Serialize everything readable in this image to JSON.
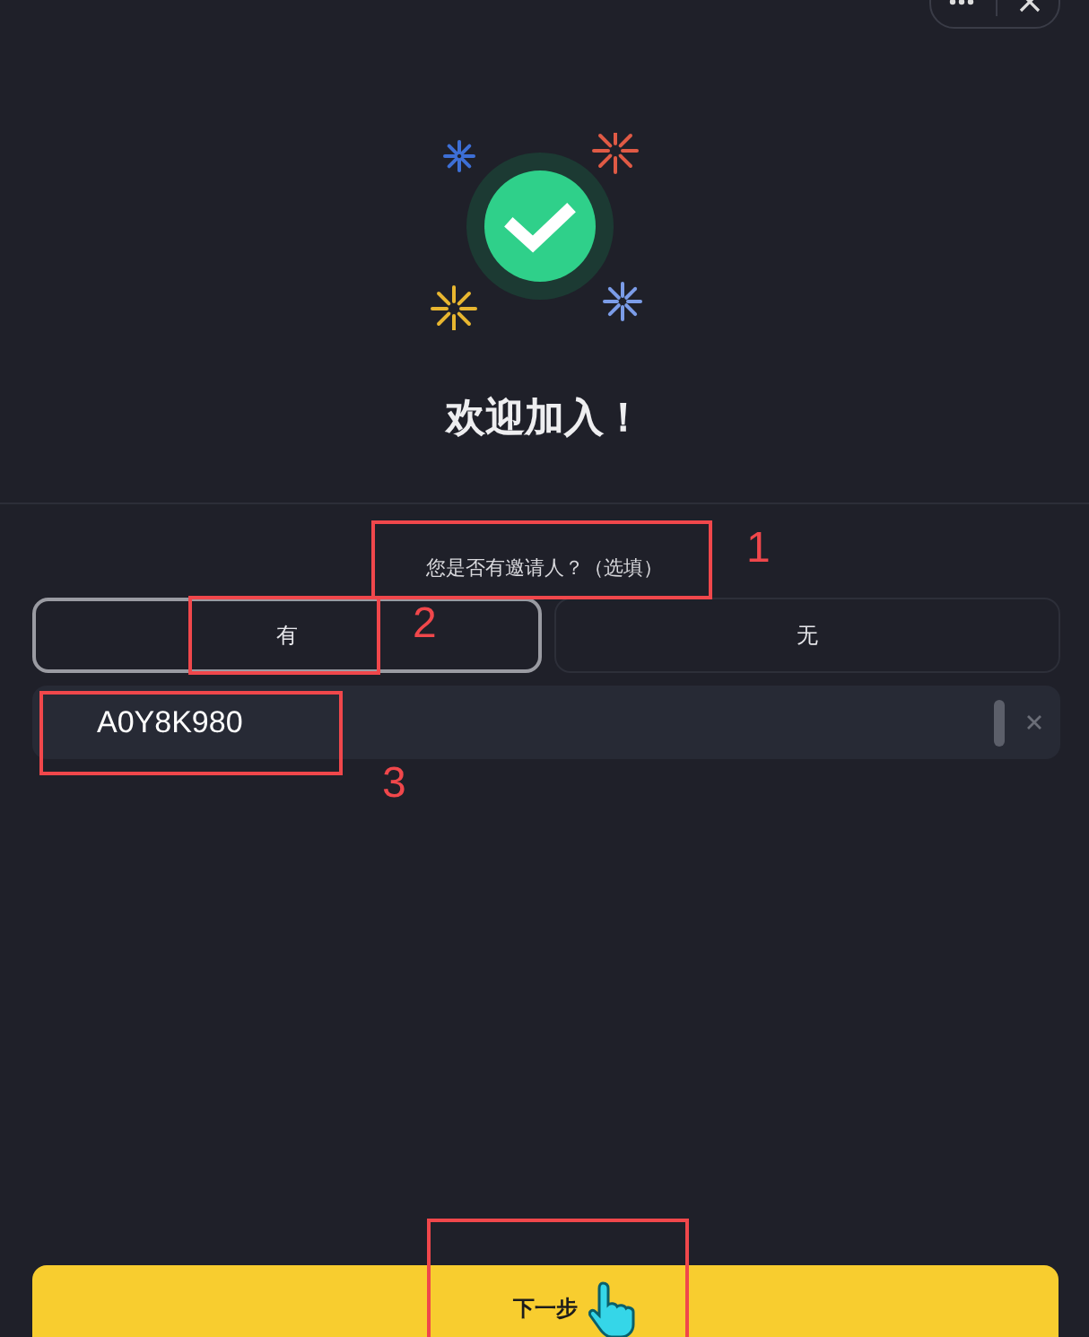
{
  "title": "欢迎加入！",
  "question": "您是否有邀请人？（选填）",
  "options": [
    {
      "label": "有",
      "selected": true
    },
    {
      "label": "无",
      "selected": false
    }
  ],
  "invite_field": {
    "value": "A0Y8K980"
  },
  "next_button": {
    "label": "下一步"
  },
  "annotations": [
    {
      "kind": "numbered",
      "label": "1"
    },
    {
      "kind": "numbered",
      "label": "2"
    },
    {
      "kind": "numbered",
      "label": "3"
    },
    {
      "kind": "plain"
    }
  ]
}
